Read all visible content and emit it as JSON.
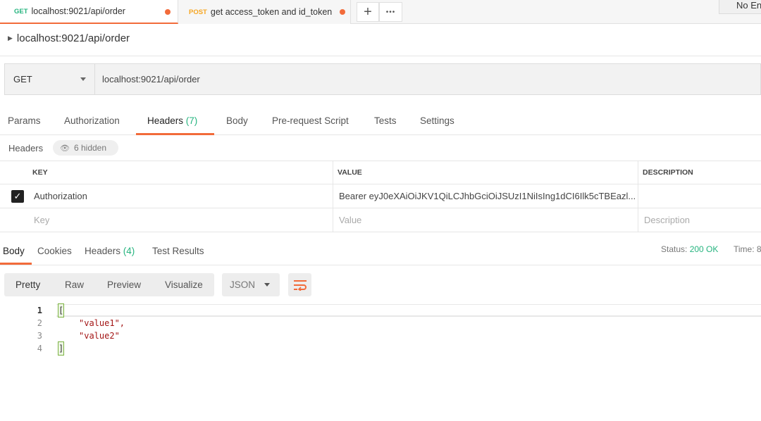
{
  "tabs": [
    {
      "method": "GET",
      "method_color": "#26b47f",
      "title": "localhost:9021/api/order",
      "active": true
    },
    {
      "method": "POST",
      "method_color": "#f6a623",
      "title": "get access_token and id_token",
      "active": false
    }
  ],
  "tab_actions": {
    "add_label": "+",
    "more_label": "•••"
  },
  "environment": {
    "label": "No Environment"
  },
  "breadcrumb": {
    "title": "localhost:9021/api/order"
  },
  "request": {
    "method": "GET",
    "url": "localhost:9021/api/order"
  },
  "request_tabs": [
    {
      "label": "Params"
    },
    {
      "label": "Authorization"
    },
    {
      "label": "Headers",
      "count": "(7)"
    },
    {
      "label": "Body"
    },
    {
      "label": "Pre-request Script"
    },
    {
      "label": "Tests"
    },
    {
      "label": "Settings"
    }
  ],
  "headers_section": {
    "label": "Headers",
    "hidden_label": "6 hidden"
  },
  "headers_table": {
    "columns": [
      "KEY",
      "VALUE",
      "DESCRIPTION"
    ],
    "rows": [
      {
        "checked": true,
        "key": "Authorization",
        "value": "Bearer eyJ0eXAiOiJKV1QiLCJhbGciOiJSUzI1NiIsIng1dCI6Ilk5cTBEazl...",
        "description": ""
      }
    ],
    "placeholders": {
      "key": "Key",
      "value": "Value",
      "description": "Description"
    }
  },
  "response_tabs": [
    {
      "label": "Body"
    },
    {
      "label": "Cookies"
    },
    {
      "label": "Headers",
      "count": "(4)"
    },
    {
      "label": "Test Results"
    }
  ],
  "response_status": {
    "status_label": "Status:",
    "status_value": "200 OK",
    "time_label": "Time: 8"
  },
  "view_options": [
    "Pretty",
    "Raw",
    "Preview",
    "Visualize"
  ],
  "format": {
    "selected": "JSON"
  },
  "code": {
    "line_numbers": [
      "1",
      "2",
      "3",
      "4"
    ],
    "lines": [
      "[",
      "\"value1\",",
      "\"value2\"",
      "]"
    ]
  },
  "colors": {
    "accent": "#f26b3a",
    "success": "#26b47f",
    "post": "#f6a623"
  }
}
